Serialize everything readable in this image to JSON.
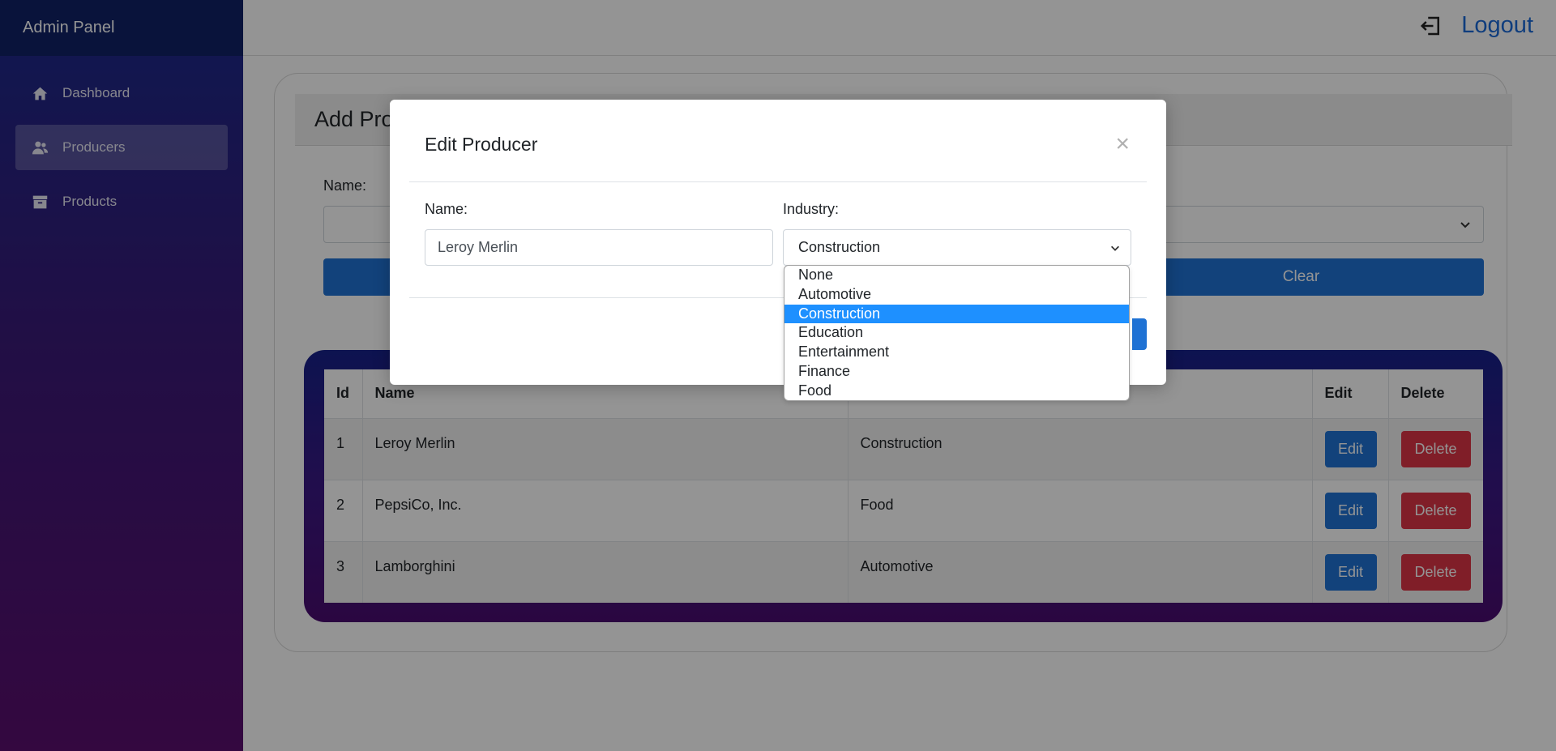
{
  "app": {
    "title": "Admin Panel"
  },
  "sidebar": {
    "items": [
      {
        "label": "Dashboard",
        "icon": "home-icon",
        "active": false
      },
      {
        "label": "Producers",
        "icon": "users-icon",
        "active": true
      },
      {
        "label": "Products",
        "icon": "box-icon",
        "active": false
      }
    ]
  },
  "topbar": {
    "logout_label": "Logout",
    "logout_icon": "logout-icon"
  },
  "page": {
    "card_title": "Add Pro",
    "name_label": "Name:",
    "clear_label": "Clear"
  },
  "table": {
    "headers": {
      "id": "Id",
      "name": "Name",
      "industry": "",
      "edit": "Edit",
      "delete": "Delete"
    },
    "rows": [
      {
        "id": "1",
        "name": "Leroy Merlin",
        "industry": "Construction",
        "edit": "Edit",
        "delete": "Delete"
      },
      {
        "id": "2",
        "name": "PepsiCo, Inc.",
        "industry": "Food",
        "edit": "Edit",
        "delete": "Delete"
      },
      {
        "id": "3",
        "name": "Lamborghini",
        "industry": "Automotive",
        "edit": "Edit",
        "delete": "Delete"
      }
    ]
  },
  "modal": {
    "title": "Edit Producer",
    "close_symbol": "×",
    "name_label": "Name:",
    "name_value": "Leroy Merlin",
    "industry_label": "Industry:",
    "industry_value": "Construction",
    "industry_options": [
      "None",
      "Automotive",
      "Construction",
      "Education",
      "Entertainment",
      "Finance",
      "Food"
    ],
    "selected_index": 2
  },
  "colors": {
    "primary": "#1f72d4",
    "danger": "#dc3545",
    "selected_option": "#1e90ff",
    "logout_text": "#1b6ad8"
  }
}
